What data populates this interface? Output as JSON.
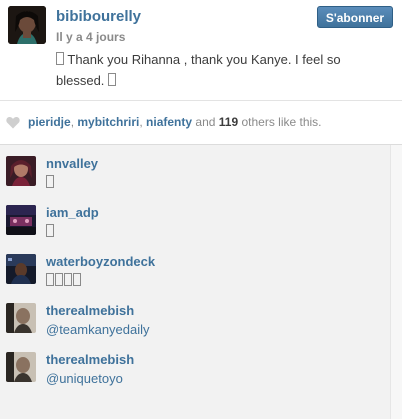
{
  "post": {
    "username": "bibibourelly",
    "time_prefix": "Il y a ",
    "time_value": "4 jours",
    "caption": "Thank you Rihanna , thank you Kanye. I feel so blessed.",
    "follow_label": "S'abonner"
  },
  "likes": {
    "users": [
      "pieridje",
      "mybitchriri",
      "niafenty"
    ],
    "and_text": "and",
    "count": "119",
    "suffix": "others like this."
  },
  "comments": [
    {
      "user": "nnvalley",
      "text": "",
      "emoji_count": 1
    },
    {
      "user": "iam_adp",
      "text": "",
      "emoji_count": 1
    },
    {
      "user": "waterboyzondeck",
      "text": "",
      "emoji_count": 4
    },
    {
      "user": "therealmebish",
      "text": "@teamkanyedaily",
      "emoji_count": 0
    },
    {
      "user": "therealmebish",
      "text": "@uniquetoyo",
      "emoji_count": 0
    }
  ],
  "colors": {
    "link_blue": "#3f729b",
    "button_blue": "#3f729b",
    "muted_text": "#8a8a8a",
    "comments_bg": "#f2f2f2"
  },
  "icons": [
    "heart-icon",
    "emoji-placeholder-box"
  ]
}
